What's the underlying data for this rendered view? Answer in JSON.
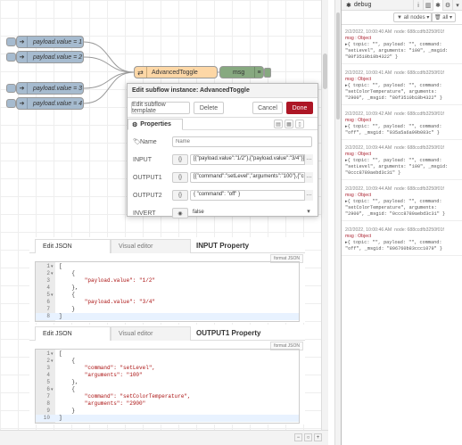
{
  "canvas": {
    "injects": [
      {
        "label": "payload.value = 1"
      },
      {
        "label": "payload.value = 2"
      },
      {
        "label": "payload.value = 3"
      },
      {
        "label": "payload.value = 4"
      }
    ],
    "toggle_node_label": "AdvancedToggle",
    "debug_node_label": "msg"
  },
  "tray": {
    "title": "Edit subflow instance: AdvancedToggle",
    "edit_template_label": "Edit subflow template",
    "delete_label": "Delete",
    "cancel_label": "Cancel",
    "done_label": "Done",
    "tab_properties": "Properties",
    "name_label": "Name",
    "name_placeholder": "Name",
    "rows": [
      {
        "label": "INPUT",
        "type": "{}",
        "value": "[{\"payload.value\":\"1/2\"},{\"payload.value\":\"3/4\"}]"
      },
      {
        "label": "OUTPUT1",
        "type": "{}",
        "value": "[{\"command\":\"setLevel\",\"arguments\":\"100\"},{\"command\""
      },
      {
        "label": "OUTPUT2",
        "type": "{}",
        "value": "{ \"command\": \"off\" }"
      },
      {
        "label": "INVERT",
        "type": "◉",
        "value": "false"
      }
    ]
  },
  "sidebar": {
    "title": "debug",
    "filter_label": "all nodes",
    "scope_label": "all",
    "messages": [
      {
        "time": "2/2/2022, 10:00:40 AM",
        "node": "node: 688ccdfb3250f01f",
        "type": "msg : Object",
        "line1": "▸{ topic: \"\", payload: \"\", command:",
        "line2": "\"setLevel\", arguments: \"100\", _msgid:",
        "line3": "\"80f3510b18b4322\" }"
      },
      {
        "time": "2/2/2022, 10:00:41 AM",
        "node": "node: 688ccdfb3250f01f",
        "type": "msg : Object",
        "line1": "▸{ topic: \"\", payload: \"\", command:",
        "line2": "\"setColorTemperature\", arguments:",
        "line3": "\"2900\", _msgid: \"80f3510b18b4322\" }"
      },
      {
        "time": "2/2/2022, 10:09:42 AM",
        "node": "node: 688ccdfb3250f01f",
        "type": "msg : Object",
        "line1": "▸{ topic: \"\", payload: \"\", command:",
        "line2": "\"off\", _msgid: \"035a5a6a99b083c\" }",
        "line3": ""
      },
      {
        "time": "2/2/2022, 10:09:44 AM",
        "node": "node: 688ccdfb3250f01f",
        "type": "msg : Object",
        "line1": "▸{ topic: \"\", payload: \"\", command:",
        "line2": "\"setLevel\", arguments: \"100\", _msgid:",
        "line3": "\"0ccc8789aebd3c31\" }"
      },
      {
        "time": "2/2/2022, 10:09:44 AM",
        "node": "node: 688ccdfb3250f01f",
        "type": "msg : Object",
        "line1": "▸{ topic: \"\", payload: \"\", command:",
        "line2": "\"setColorTemperature\", arguments:",
        "line3": "\"2900\", _msgid: \"0ccc8789aebd3c31\" }"
      },
      {
        "time": "2/2/2022, 10:00:46 AM",
        "node": "node: 688ccdfb3250f01f",
        "type": "msg : Object",
        "line1": "▸{ topic: \"\", payload: \"\", command:",
        "line2": "\"off\", _msgid: \"896760b83ccc1079\" }",
        "line3": ""
      }
    ]
  },
  "json_input": {
    "tab_edit": "Edit JSON",
    "tab_visual": "Visual editor",
    "title": "INPUT Property",
    "format_label": "format JSON",
    "lines": [
      {
        "n": "1",
        "f": "▾",
        "code": "["
      },
      {
        "n": "2",
        "f": "▾",
        "code": "    {"
      },
      {
        "n": "3",
        "f": "",
        "code": "        \"payload.value\": \"1/2\""
      },
      {
        "n": "4",
        "f": "",
        "code": "    },"
      },
      {
        "n": "5",
        "f": "▾",
        "code": "    {"
      },
      {
        "n": "6",
        "f": "",
        "code": "        \"payload.value\": \"3/4\""
      },
      {
        "n": "7",
        "f": "",
        "code": "    }"
      },
      {
        "n": "8",
        "f": "",
        "code": "]"
      }
    ]
  },
  "json_output": {
    "tab_edit": "Edit JSON",
    "tab_visual": "Visual editor",
    "title": "OUTPUT1 Property",
    "format_label": "format JSON",
    "lines": [
      {
        "n": "1",
        "f": "▾",
        "code": "["
      },
      {
        "n": "2",
        "f": "▾",
        "code": "    {"
      },
      {
        "n": "3",
        "f": "",
        "code": "        \"command\": \"setLevel\","
      },
      {
        "n": "4",
        "f": "",
        "code": "        \"arguments\": \"100\""
      },
      {
        "n": "5",
        "f": "",
        "code": "    },"
      },
      {
        "n": "6",
        "f": "▾",
        "code": "    {"
      },
      {
        "n": "7",
        "f": "",
        "code": "        \"command\": \"setColorTemperature\","
      },
      {
        "n": "8",
        "f": "",
        "code": "        \"arguments\": \"2900\""
      },
      {
        "n": "9",
        "f": "",
        "code": "    }"
      },
      {
        "n": "10",
        "f": "",
        "code": "]"
      }
    ]
  }
}
